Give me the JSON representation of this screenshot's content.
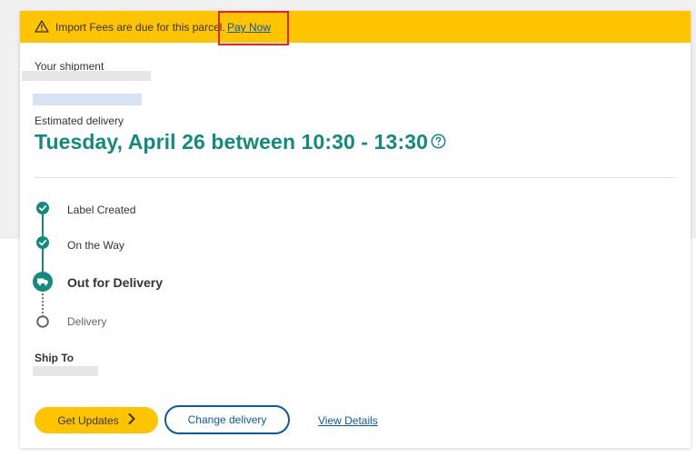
{
  "banner": {
    "message": "Import Fees are due for this parcel.",
    "pay_link": "Pay Now",
    "icon": "warning-icon"
  },
  "shipment": {
    "label": "Your shipment"
  },
  "estimated_delivery": {
    "label": "Estimated delivery",
    "value": "Tuesday, April 26 between 10:30 - 13:30"
  },
  "timeline": {
    "steps": [
      {
        "label": "Label Created",
        "status": "complete"
      },
      {
        "label": "On the Way",
        "status": "complete"
      },
      {
        "label": "Out for Delivery",
        "status": "current"
      },
      {
        "label": "Delivery",
        "status": "pending"
      }
    ]
  },
  "ship_to": {
    "label": "Ship To"
  },
  "actions": {
    "get_updates": "Get Updates",
    "change_delivery": "Change delivery",
    "view_details": "View Details"
  },
  "colors": {
    "banner": "#ffc400",
    "accent_teal": "#138a80",
    "link_blue": "#0b5aa5",
    "highlight_red": "#e0262b"
  }
}
